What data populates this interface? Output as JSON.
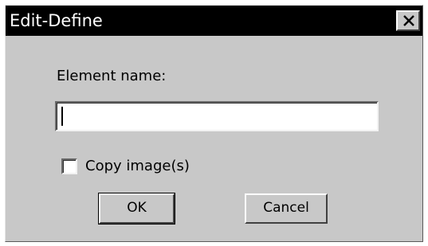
{
  "window": {
    "title": "Edit-Define",
    "close_icon": "close-icon"
  },
  "form": {
    "name_label": "Element name:",
    "name_value": "",
    "copy_images_label": "Copy image(s)",
    "copy_images_checked": false
  },
  "buttons": {
    "ok_label": "OK",
    "cancel_label": "Cancel"
  }
}
